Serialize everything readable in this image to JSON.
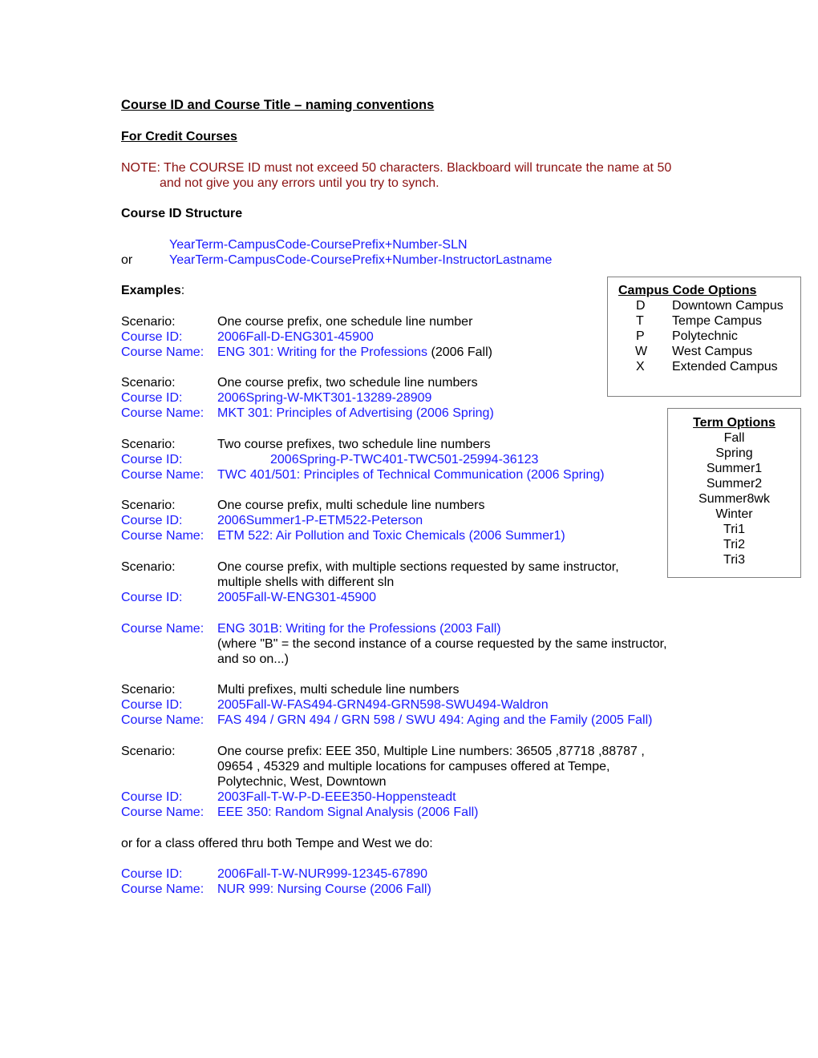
{
  "title": "Course ID and Course Title – naming conventions",
  "subtitle": "For Credit Courses",
  "note": {
    "line1": "NOTE: The COURSE ID must not exceed 50 characters.  Blackboard will truncate the name at 50",
    "line2": "and not give you any errors until you try to synch."
  },
  "structure": {
    "heading": "Course ID Structure",
    "pattern1": "YearTerm-CampusCode-CoursePrefix+Number-SLN",
    "or_label": "or",
    "pattern2": "YearTerm-CampusCode-CoursePrefix+Number-InstructorLastname"
  },
  "examples_heading": "Examples",
  "examples_colon": ":",
  "labels": {
    "scenario": "Scenario:",
    "course_id": "Course ID:",
    "course_name": "Course Name:"
  },
  "examples": [
    {
      "scenario": "One course prefix, one schedule line number",
      "course_id": "2006Fall-D-ENG301-45900",
      "course_name": "ENG 301: Writing for the Professions",
      "course_name_suffix": " (2006 Fall)"
    },
    {
      "scenario": "One course prefix, two schedule line numbers",
      "course_id": "2006Spring-W-MKT301-13289-28909",
      "course_name": "MKT 301: Principles of Advertising (2006 Spring)"
    },
    {
      "scenario": "Two course prefixes, two schedule line numbers",
      "course_id": "2006Spring-P-TWC401-TWC501-25994-36123",
      "course_name": "TWC 401/501: Principles of Technical Communication (2006 Spring)"
    },
    {
      "scenario": "One course prefix, multi schedule line numbers",
      "course_id": "2006Summer1-P-ETM522-Peterson",
      "course_name": "ETM 522: Air Pollution and Toxic Chemicals (2006 Summer1)"
    },
    {
      "scenario_line1": "One course prefix, with multiple sections requested by same instructor,",
      "scenario_line2": "multiple shells with different sln",
      "course_id": "2005Fall-W-ENG301-45900",
      "course_name": "ENG 301B: Writing for the Professions (2003 Fall)",
      "note_line1": "(where \"B\" = the second instance of a course requested by the same instructor,",
      "note_line2": "and so on...)"
    },
    {
      "scenario": "Multi prefixes, multi schedule line numbers",
      "course_id": "2005Fall-W-FAS494-GRN494-GRN598-SWU494-Waldron",
      "course_name": "FAS 494 / GRN 494 / GRN 598 / SWU 494: Aging and the Family (2005 Fall)"
    },
    {
      "scenario_line1": "One course prefix:  EEE 350, Multiple Line numbers: 36505 ,87718 ,88787 ,",
      "scenario_line2": "09654 , 45329 and multiple locations for campuses offered at Tempe,",
      "scenario_line3": "Polytechnic, West, Downtown",
      "course_id": "2003Fall-T-W-P-D-EEE350-Hoppensteadt",
      "course_name": "EEE 350: Random Signal Analysis (2006 Fall)"
    }
  ],
  "alt_text": "or for a class offered thru both Tempe and West we do:",
  "alt_example": {
    "course_id": "2006Fall-T-W-NUR999-12345-67890",
    "course_name": "NUR 999: Nursing Course (2006 Fall)"
  },
  "campus_box": {
    "heading": "Campus Code Options",
    "items": [
      {
        "code": "D",
        "name": "Downtown Campus"
      },
      {
        "code": "T",
        "name": "Tempe Campus"
      },
      {
        "code": "P",
        "name": "Polytechnic"
      },
      {
        "code": "W",
        "name": "West Campus"
      },
      {
        "code": "X",
        "name": "Extended Campus"
      }
    ]
  },
  "term_box": {
    "heading": "Term Options",
    "items": [
      "Fall",
      "Spring",
      "Summer1",
      "Summer2",
      "Summer8wk",
      "Winter",
      "Tri1",
      "Tri2",
      "Tri3"
    ]
  },
  "colors": {
    "note": "#8b1010",
    "link_blue": "#1a1aff",
    "text": "#000000",
    "box_border": "#808080"
  }
}
